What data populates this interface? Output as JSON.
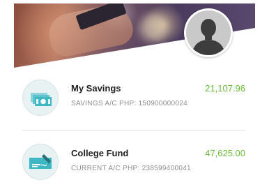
{
  "hero": {
    "image": "user-background-photo"
  },
  "profile": {
    "icon": "person-silhouette-icon"
  },
  "accounts": [
    {
      "name": "My Savings",
      "amount": "21,107.96",
      "detail": "SAVINGS A/C PHP: 150900000024",
      "icon": "cash-money-icon"
    },
    {
      "name": "College Fund",
      "amount": "47,625.00",
      "detail": "CURRENT A/C PHP: 238599400041",
      "icon": "check-cheque-icon"
    }
  ],
  "colors": {
    "amount": "#6cbb3c",
    "icon_accent": "#3fb8c4"
  }
}
